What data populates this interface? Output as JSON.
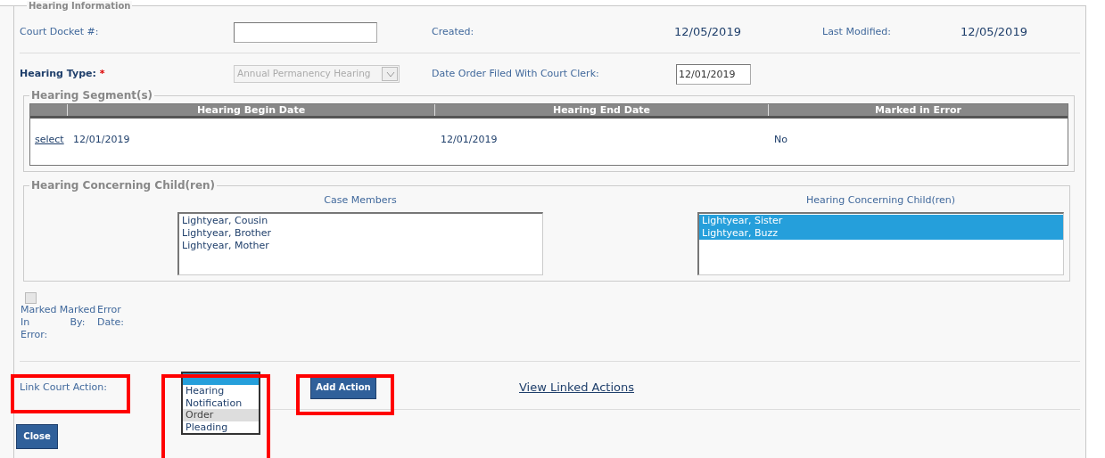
{
  "section_title": "Hearing Information",
  "court_docket": {
    "label": "Court Docket #:"
  },
  "created": {
    "label": "Created:",
    "value": "12/05/2019"
  },
  "last_modified": {
    "label": "Last Modified:",
    "value": "12/05/2019"
  },
  "hearing_type": {
    "label": "Hearing Type:",
    "required_mark": "*",
    "value": "Annual Permanency Hearing",
    "disabled": true
  },
  "date_order_filed": {
    "label": "Date Order Filed With Court Clerk:",
    "value": "12/01/2019"
  },
  "hearing_segments": {
    "legend": "Hearing Segment(s)",
    "columns": [
      "Hearing Begin Date",
      "Hearing End Date",
      "Marked in Error"
    ],
    "rows": [
      {
        "link": "select",
        "cells": [
          "12/01/2019",
          "12/01/2019",
          "No"
        ]
      }
    ]
  },
  "children_section": {
    "legend": "Hearing Concerning Child(ren)",
    "case_members": {
      "label": "Case Members",
      "items": [
        {
          "label": "Lightyear, Cousin",
          "selected": false
        },
        {
          "label": "Lightyear, Brother",
          "selected": false
        },
        {
          "label": "Lightyear, Mother",
          "selected": false
        }
      ]
    },
    "concerning": {
      "label": "Hearing Concerning Child(ren)",
      "items": [
        {
          "label": "Lightyear, Sister",
          "selected": true
        },
        {
          "label": "Lightyear, Buzz",
          "selected": true
        }
      ]
    }
  },
  "marked_in_error": {
    "checked": false,
    "disabled": true,
    "labels": [
      "Marked In Error:",
      "Marked By:",
      "Error Date:"
    ]
  },
  "link_court_action": {
    "label": "Link Court Action:",
    "highlighted": true
  },
  "action_list": {
    "highlighted": true,
    "items": [
      {
        "selected": true,
        "hovered": false
      },
      {
        "label": "Hearing",
        "selected": false,
        "hovered": false
      },
      {
        "label": "Notification",
        "selected": false,
        "hovered": false
      },
      {
        "label": "Order",
        "selected": false,
        "hovered": true
      },
      {
        "label": "Pleading",
        "selected": false,
        "hovered": false
      }
    ]
  },
  "add_action_button": {
    "label": "Add Action",
    "highlighted": true
  },
  "view_linked_actions": "View Linked Actions",
  "close_button": "Close"
}
